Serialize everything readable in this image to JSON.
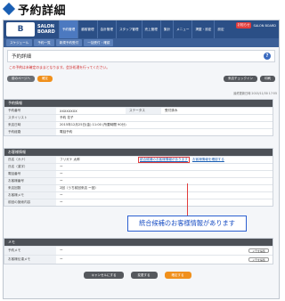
{
  "heading": {
    "title": "予約詳細"
  },
  "topbar": {
    "logo_text": "B",
    "brand_line1": "SALON",
    "brand_line2": "BOARD",
    "nav": [
      "予約管理",
      "顧客管理",
      "会計管理",
      "スタッフ管理",
      "売上管理",
      "集計",
      "メニュー",
      "掲載・設定",
      "設定"
    ],
    "active_index": 0,
    "badge": "お知らせ",
    "user": "SALON BOARD"
  },
  "subnav": {
    "tabs": [
      "スケジュール",
      "予約一覧",
      "新規予約受付",
      "一括受付・確認"
    ]
  },
  "page": {
    "title": "予約詳細",
    "warning": "この予約は未確定のままとなります。会計処理を行ってください。",
    "back_button": "前のページへ",
    "confirm_button": "確定",
    "checkin_button": "来店チェックイン",
    "print_button": "印刷",
    "updated": "最終更新日時 2015/11/30 17:55"
  },
  "reservation": {
    "header": "予約情報",
    "rows": [
      {
        "k": "予約番号",
        "v": "XXXXXXXX",
        "k2": "ステータス",
        "v2": "受付済み"
      },
      {
        "k": "スタイリスト",
        "v": "予約 花子"
      },
      {
        "k": "来店日時",
        "v": "2015年12月25日(金) 11:00 (所要時間 90分)"
      },
      {
        "k": "予約経路",
        "v": "電話予約"
      }
    ]
  },
  "customer": {
    "header": "お客様情報",
    "rows": [
      {
        "k": "氏名（カナ）",
        "v": "フリガナ 太郎",
        "link1": "統合候補のお客様情報があります",
        "link2": "お客様情報を確認する"
      },
      {
        "k": "氏名（漢字）",
        "v": "ー"
      },
      {
        "k": "電話番号",
        "v": "ー"
      },
      {
        "k": "お客様番号",
        "v": "ー"
      },
      {
        "k": "来店回数",
        "v": "2回（うち前回来店 ー回）"
      },
      {
        "k": "お客様メモ",
        "v": "ー"
      },
      {
        "k": "前回の施術内容",
        "v": "ー"
      }
    ]
  },
  "memo": {
    "header": "メモ",
    "rows": [
      {
        "k": "予約メモ",
        "v": "ー",
        "btn": "メモを編集"
      },
      {
        "k": "お客様伝達メモ",
        "v": "ー",
        "btn": "メモを編集"
      }
    ]
  },
  "callout": {
    "text": "統合候補のお客様情報があります"
  },
  "footer": {
    "cancel": "キャンセルにする",
    "change": "変更する",
    "confirm": "確定する"
  },
  "colors": {
    "nav": "#2b4f86",
    "accent": "#f0901c",
    "link": "#1a5fb4",
    "warning": "#d12a2a"
  }
}
